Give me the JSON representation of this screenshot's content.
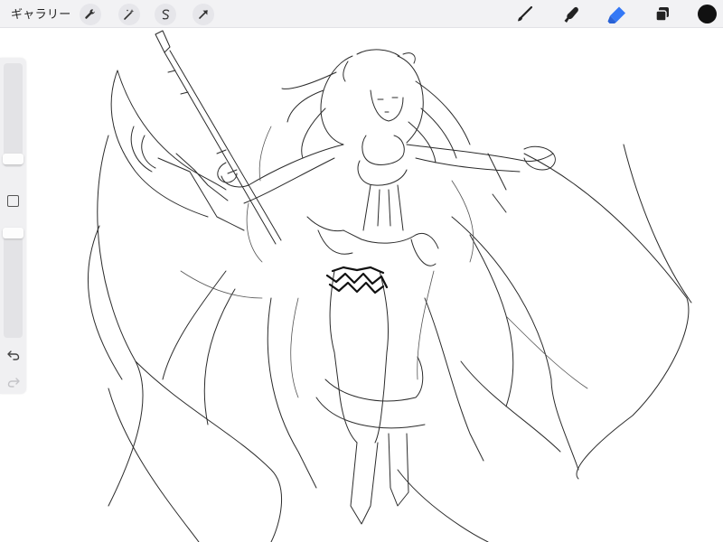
{
  "topbar": {
    "gallery_label": "ギャラリー",
    "left_tools": [
      {
        "name": "actions",
        "icon": "wrench-icon"
      },
      {
        "name": "adjustments",
        "icon": "magic-wand-icon"
      },
      {
        "name": "selection",
        "icon": "selection-s-icon"
      },
      {
        "name": "transform",
        "icon": "arrow-cursor-icon"
      }
    ],
    "right_tools": [
      {
        "name": "brush",
        "icon": "brush-icon",
        "active": false
      },
      {
        "name": "smudge",
        "icon": "smudge-finger-icon",
        "active": false
      },
      {
        "name": "eraser",
        "icon": "eraser-icon",
        "active": true
      },
      {
        "name": "layers",
        "icon": "layers-icon",
        "active": false
      }
    ],
    "current_color": "#111111",
    "accent_color": "#3478f6"
  },
  "sidebar": {
    "brush_size_level": 0.0,
    "opacity_level": 1.0,
    "modifier_icon": "square-modifier-icon",
    "undo_icon": "undo-icon",
    "redo_icon": "redo-icon",
    "redo_enabled": false
  },
  "canvas": {
    "content": "line-art-sketch"
  }
}
